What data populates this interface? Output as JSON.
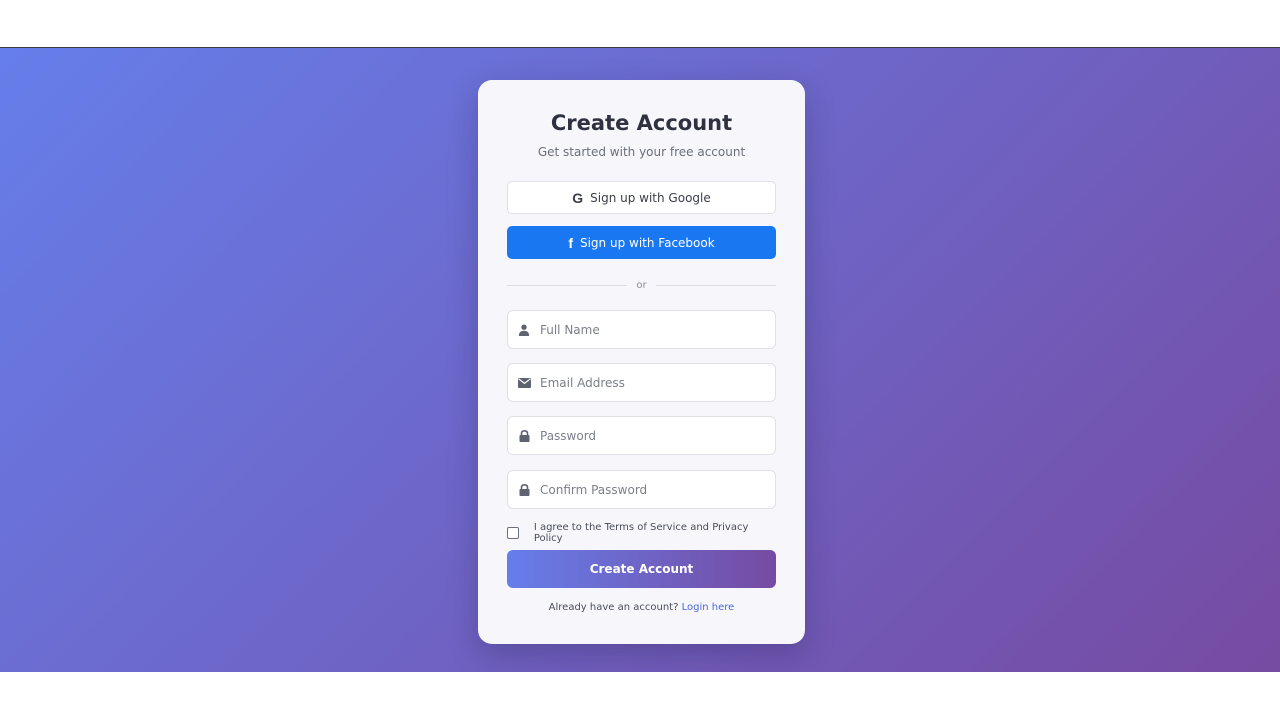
{
  "card": {
    "title": "Create Account",
    "subtitle": "Get started with your free account"
  },
  "social": {
    "google_label": "Sign up with Google",
    "google_icon": "google-icon",
    "facebook_label": "Sign up with Facebook",
    "facebook_icon": "facebook-icon",
    "facebook_color": "#1a77f2"
  },
  "divider": {
    "text": "or"
  },
  "form": {
    "full_name": {
      "placeholder": "Full Name",
      "value": "",
      "icon": "user-icon"
    },
    "email": {
      "placeholder": "Email Address",
      "value": "",
      "icon": "envelope-icon"
    },
    "password": {
      "placeholder": "Password",
      "value": "",
      "icon": "lock-icon"
    },
    "confirm_password": {
      "placeholder": "Confirm Password",
      "value": "",
      "icon": "lock-icon"
    },
    "terms_label": "I agree to the Terms of Service and Privacy Policy",
    "terms_checked": false,
    "submit_label": "Create Account"
  },
  "footer": {
    "prompt": "Already have an account?",
    "login_link": "Login here"
  },
  "colors": {
    "gradient_start": "#667eea",
    "gradient_end": "#764ba2",
    "link": "#4a67d6"
  }
}
